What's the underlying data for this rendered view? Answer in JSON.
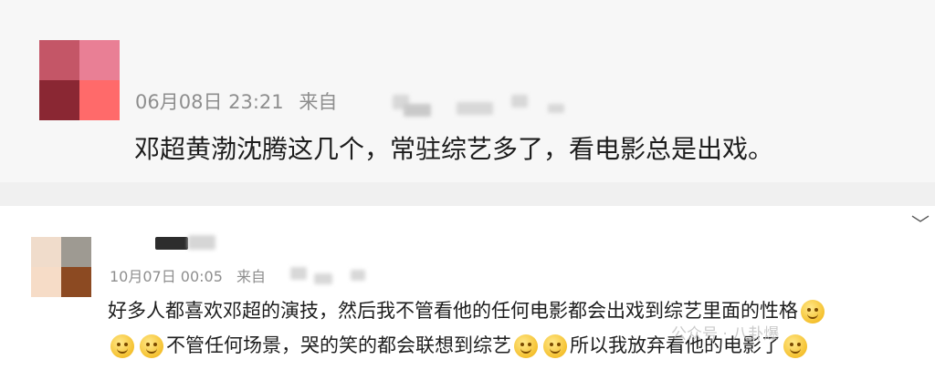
{
  "comments": [
    {
      "date": "06月08日 23:21",
      "source_label": "来自",
      "text": "邓超黄渤沈腾这几个，常驻综艺多了，看电影总是出戏。",
      "avatar_colors": [
        "#c45667",
        "#e97f95",
        "#8a2733",
        "#ff6a6a"
      ]
    },
    {
      "date": "10月07日 00:05",
      "source_label": "来自",
      "text_line1": "好多人都喜欢邓超的演技，然后我不管看他的任何电影都会出戏到综艺里面的性格",
      "text_line2a": "不管任何场景，哭的笑的都会联想到综艺",
      "text_line2b": "所以我放弃看他的电影了",
      "avatar_colors": [
        "#f0dccb",
        "#9e9a92",
        "#f6dcc7",
        "#8c4a22"
      ]
    }
  ],
  "icons": {
    "emoji": "smile-emoji-icon",
    "chevron": "chevron-down-icon"
  },
  "chevron_glyph": "﹀",
  "watermark": "公众号 · 八卦爆"
}
